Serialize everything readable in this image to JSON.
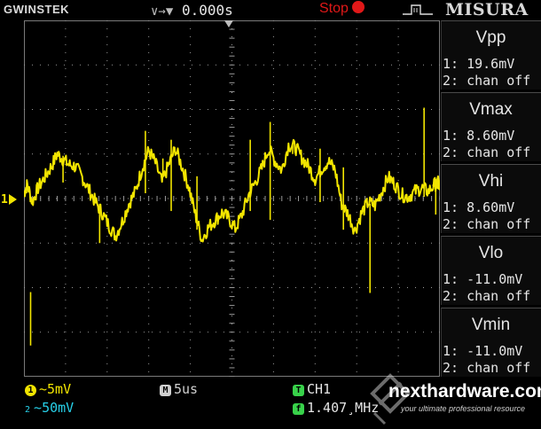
{
  "topbar": {
    "brand": "GWINSTEK",
    "trigger_glyphs": "∨→▼",
    "trigger_position": "0.000s",
    "run_status": "Stop",
    "menu_title": "MISURA"
  },
  "colors": {
    "trace": "#f2e500",
    "ch2": "#27d0e8",
    "ch1_badge": "#f2e500",
    "run_status": "#e01818",
    "grid": "#9a9a9a",
    "trigger_badge": "#38d24a"
  },
  "measurements": [
    {
      "name": "Vpp",
      "ch1": "1: 19.6mV",
      "ch2": "2: chan off"
    },
    {
      "name": "Vmax",
      "ch1": "1: 8.60mV",
      "ch2": "2: chan off"
    },
    {
      "name": "Vhi",
      "ch1": "1: 8.60mV",
      "ch2": "2: chan off"
    },
    {
      "name": "Vlo",
      "ch1": "1: -11.0mV",
      "ch2": "2: chan off"
    },
    {
      "name": "Vmin",
      "ch1": "1: -11.0mV",
      "ch2": "2: chan off"
    }
  ],
  "channels": {
    "ch1_marker": "1",
    "ch1_scale": "5mV",
    "ch2_scale": "50mV",
    "timebase": "5us",
    "trigger_source": "CH1",
    "frequency": "1.407¸MHz"
  },
  "watermark": {
    "name": "nexthardware.com",
    "tagline": "your ultimate professional resource"
  },
  "chart_data": {
    "type": "line",
    "grid": {
      "divisions_x": 10,
      "divisions_y": 8
    },
    "grid_on": true,
    "ylim": [
      -20,
      20
    ],
    "xlim": [
      -25,
      25
    ],
    "units": {
      "x": "us",
      "y": "mV"
    },
    "series": [
      {
        "x": [
          -25,
          -24.6,
          -24,
          -23.3,
          -22.5,
          -21.7,
          -21,
          -20.3,
          -19.6,
          -18.8,
          -18,
          -17.2,
          -16.4,
          -15.6,
          -14.8,
          -14,
          -13.2,
          -12.4,
          -11.6,
          -10.8,
          -10,
          -9.2,
          -8.4,
          -7.6,
          -6.8,
          -6,
          -5.2,
          -4.4,
          -3.6,
          -2.8,
          -2,
          -1.2,
          -0.4,
          0.4,
          1.2,
          2,
          2.8,
          3.6,
          4.4,
          5.2,
          6,
          6.8,
          7.6,
          8.4,
          9.2,
          10,
          10.8,
          11.6,
          12.4,
          13.2,
          14,
          14.8,
          15.6,
          16.4,
          17.2,
          18,
          18.8,
          19.6,
          20.4,
          21.2,
          22,
          22.8,
          23.6,
          24.4,
          25
        ],
        "values": [
          0.6,
          1.6,
          -0.4,
          1.2,
          2.4,
          3.6,
          5,
          4.4,
          3.8,
          3.6,
          2.4,
          1,
          -0.4,
          -1.6,
          -3,
          -4.2,
          -2.6,
          -0.6,
          0.8,
          3.4,
          5.4,
          4,
          1.8,
          3.8,
          5.6,
          3.6,
          1.4,
          -1.8,
          -4.6,
          -3.2,
          -2.4,
          -1.6,
          -2.2,
          -3.4,
          -1.8,
          0.4,
          1.8,
          3.4,
          5.6,
          4.2,
          3.2,
          6,
          5.8,
          4.6,
          3.6,
          2.2,
          3.4,
          4.2,
          3.2,
          -0.6,
          -1.8,
          -3.6,
          -1.6,
          -0.4,
          -0.8,
          0.8,
          2.4,
          1.6,
          0.4,
          0.2,
          0.8,
          1.2,
          0.8,
          1.6,
          1.8
        ]
      }
    ]
  }
}
